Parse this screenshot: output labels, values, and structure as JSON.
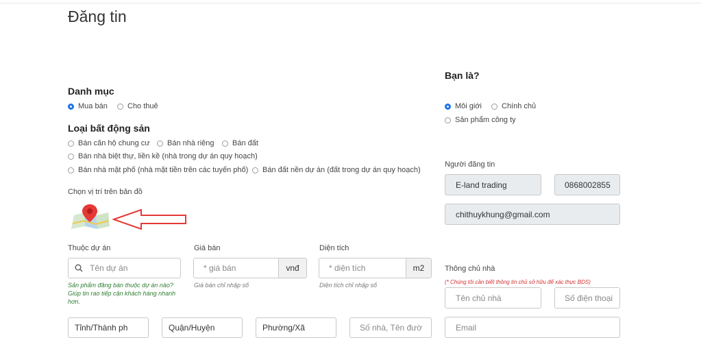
{
  "page": {
    "title": "Đăng tin"
  },
  "category": {
    "heading": "Danh mục",
    "options": [
      {
        "label": "Mua bán",
        "selected": true
      },
      {
        "label": "Cho thuê",
        "selected": false
      }
    ]
  },
  "property_type": {
    "heading": "Loại bất động sản",
    "options": [
      {
        "label": "Bán căn hộ chung cư",
        "selected": false
      },
      {
        "label": "Bán nhà riêng",
        "selected": false
      },
      {
        "label": "Bán đất",
        "selected": false
      },
      {
        "label": "Bán nhà biệt thự, liền kề (nhà trong dự án quy hoạch)",
        "selected": false
      },
      {
        "label": "Bán nhà mặt phố (nhà mặt tiền trên các tuyến phố)",
        "selected": false
      },
      {
        "label": "Bán đất nền dự án (đất trong dự án quy hoạch)",
        "selected": false
      }
    ]
  },
  "map": {
    "label": "Chọn vị trí trên bản đồ",
    "icon": "map-pin-icon",
    "arrow_color": "#e53935"
  },
  "project": {
    "label": "Thuộc dự án",
    "placeholder": "Tên dự án",
    "hint": "Sản phẩm đăng bán thuộc dự án nào? Giúp tin rao tiếp cận khách hàng nhanh hơn."
  },
  "price": {
    "label": "Giá bán",
    "placeholder": "* giá bán",
    "unit": "vnđ",
    "hint": "Giá bán chỉ nhập số"
  },
  "area": {
    "label": "Diện tích",
    "placeholder": "* diện tích",
    "unit": "m2",
    "hint": "Diện tích chỉ nhập số"
  },
  "location_row": {
    "province": "Tỉnh/Thành ph",
    "district": "Quận/Huyện",
    "ward": "Phường/Xã",
    "street": "Số nhà, Tên đườ"
  },
  "role": {
    "heading": "Bạn là?",
    "options": [
      {
        "label": "Môi giới",
        "selected": true
      },
      {
        "label": "Chính chủ",
        "selected": false
      },
      {
        "label": "Sản phẩm công ty",
        "selected": false
      }
    ]
  },
  "poster": {
    "label": "Người đăng tin",
    "name": "E-land trading",
    "phone": "0868002855",
    "email": "chithuykhung@gmail.com"
  },
  "owner": {
    "label": "Thông chủ nhà",
    "note": "(* Chúng tôi cần biết thông tin chủ sở hữu để xác thực BDS)",
    "name_placeholder": "Tên chủ nhà",
    "phone_placeholder": "Số điện thoại",
    "email_placeholder": "Email"
  },
  "colors": {
    "accent": "#1a73e8",
    "hint_green": "#2e7d32",
    "note_red": "#d32f2f"
  }
}
